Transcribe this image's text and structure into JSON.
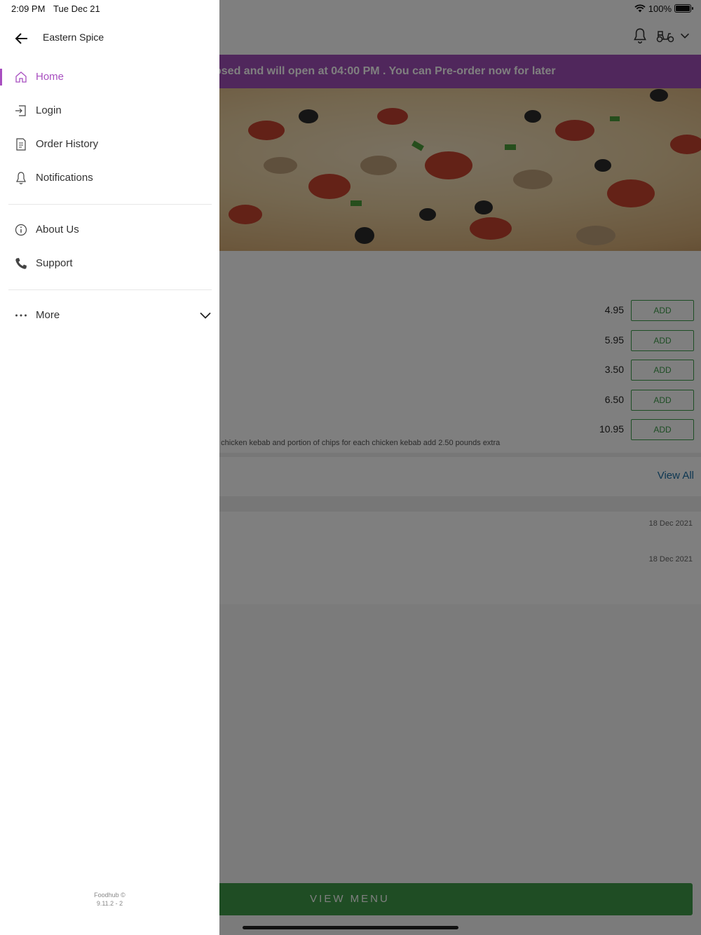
{
  "status_bar": {
    "time": "2:09 PM",
    "date": "Tue Dec 21",
    "battery": "100%"
  },
  "drawer": {
    "title": "Eastern Spice",
    "primary_items": [
      {
        "label": "Home",
        "icon": "home-icon",
        "active": true
      },
      {
        "label": "Login",
        "icon": "login-icon"
      },
      {
        "label": "Order History",
        "icon": "receipt-icon"
      },
      {
        "label": "Notifications",
        "icon": "bell-icon"
      }
    ],
    "secondary_items": [
      {
        "label": "About Us",
        "icon": "info-icon"
      },
      {
        "label": "Support",
        "icon": "phone-icon"
      }
    ],
    "more": {
      "label": "More",
      "icon": "ellipsis-icon"
    },
    "footer": {
      "brand": "Foodhub ©",
      "version": "9.11.2 - 2"
    }
  },
  "background": {
    "banner": "osed and will open at 04:00 PM . You can Pre-order now for later",
    "menu_items": [
      {
        "price": "4.95",
        "button": "ADD"
      },
      {
        "price": "5.95",
        "button": "ADD"
      },
      {
        "price": "3.50",
        "button": "ADD"
      },
      {
        "price": "6.50",
        "button": "ADD"
      },
      {
        "price": "10.95",
        "button": "ADD",
        "description": "e chicken kebab and portion of chips for each chicken kebab add 2.50 pounds extra"
      }
    ],
    "view_all": "View All",
    "notification_dates": [
      "18 Dec 2021",
      "18 Dec 2021"
    ],
    "view_menu": "VIEW MENU"
  },
  "colors": {
    "accent": "#a84fc0",
    "banner": "#a14fb8",
    "green": "#3e9a48",
    "link": "#1d6fa5"
  }
}
